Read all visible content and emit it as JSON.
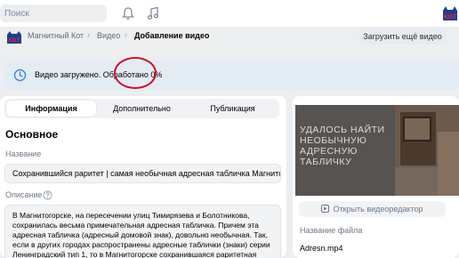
{
  "topbar": {
    "search_placeholder": "Поиск",
    "icons": [
      "bell-icon",
      "music-icon",
      "community-logo"
    ]
  },
  "breadcrumb": {
    "community": "Магнитный Кот",
    "section": "Видео",
    "current": "Добавление видео",
    "separator": "›"
  },
  "upload_more_label": "Загрузить ещё видео",
  "status": {
    "text_prefix": "Видео загружено.",
    "text_progress": "Обработано 0%",
    "icon": "clock-icon"
  },
  "tabs": [
    {
      "label": "Информация",
      "active": true
    },
    {
      "label": "Дополнительно",
      "active": false
    },
    {
      "label": "Публикация",
      "active": false
    }
  ],
  "section_title": "Основное",
  "name_field": {
    "label": "Название",
    "value": "Сохранившийся раритет | самая необычная адресная табличка Магнитогорска"
  },
  "description_field": {
    "label": "Описание",
    "value": "В Магнитогорске, на пересечении улиц Тимирязева и Болотникова, сохранилась весьма примечательная адресная табличка. Причем эта адресная табличка (адресный домовой знак), довольно необычная. Так, если в других городах распространены адресные таблички (знаки) серии Ленинградский тип 1, то в Магнитогорске сохранившаяся раритетная адресная табличка"
  },
  "preview": {
    "thumbnail_text": "Удалось найти необычную адресную табличку",
    "editor_button_label": "Открыть видеоредактор",
    "file_name_label": "Название файла",
    "file_name": "Adresn.mp4"
  },
  "colors": {
    "accent": "#2a5885",
    "highlight_ring": "#c8102e",
    "status_bg": "#e3ebf3",
    "button_bg": "#e5ebf1"
  }
}
